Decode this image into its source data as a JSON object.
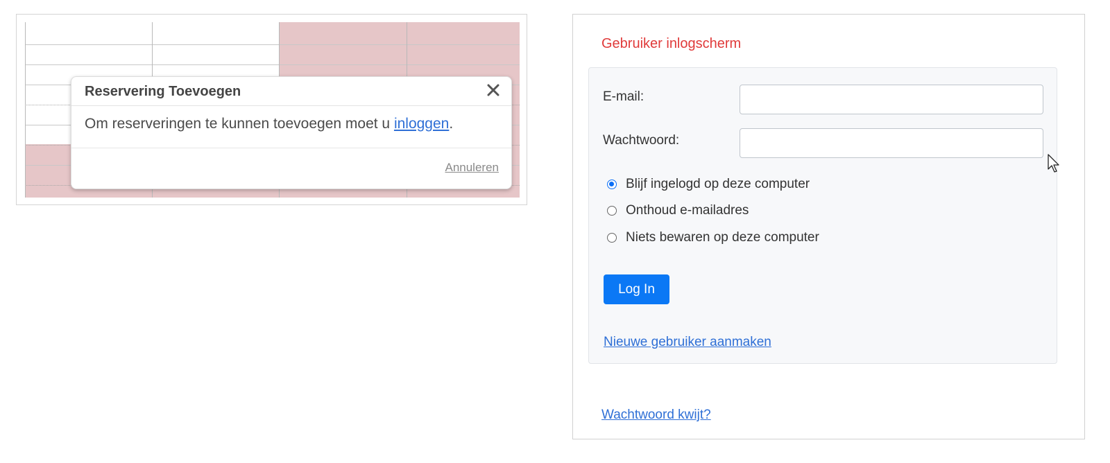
{
  "modal": {
    "title": "Reservering Toevoegen",
    "message_prefix": "Om reserveringen te kunnen toevoegen moet u ",
    "login_link": "inloggen",
    "message_suffix": ".",
    "cancel_label": "Annuleren",
    "close_icon": "close-icon"
  },
  "schedule": {
    "reserved_color": "#e6c6c8"
  },
  "login": {
    "heading": "Gebruiker inlogscherm",
    "email_label": "E-mail:",
    "email_value": "",
    "password_label": "Wachtwoord:",
    "password_value": "",
    "remember_options": [
      {
        "label": "Blijf ingelogd op deze computer",
        "checked": true
      },
      {
        "label": "Onthoud e-mailadres",
        "checked": false
      },
      {
        "label": "Niets bewaren op deze computer",
        "checked": false
      }
    ],
    "submit_label": "Log In",
    "create_user_link": "Nieuwe gebruiker aanmaken",
    "forgot_password_link": "Wachtwoord kwijt?"
  },
  "colors": {
    "heading_red": "#e03a3a",
    "primary_blue": "#0b78f5",
    "link_blue": "#2e6fd6"
  }
}
